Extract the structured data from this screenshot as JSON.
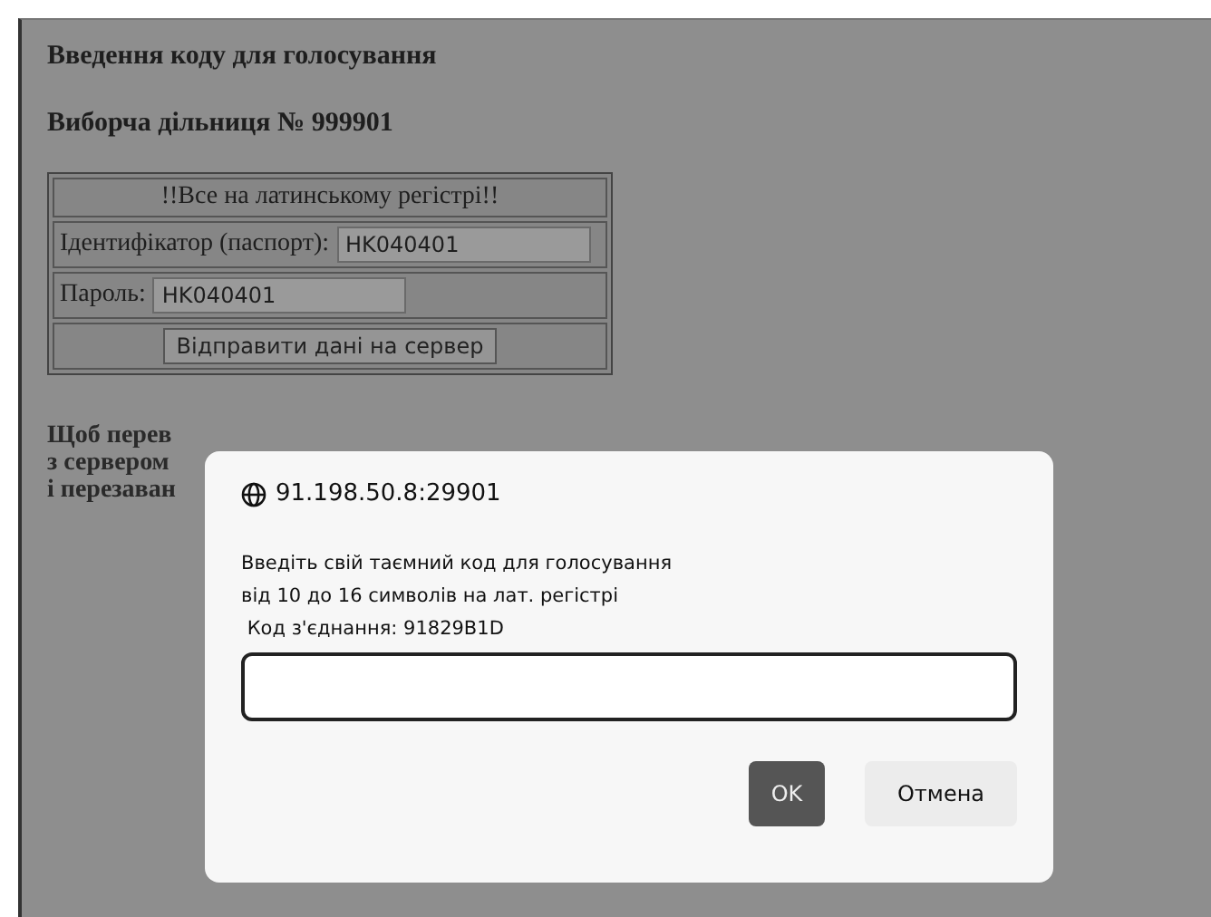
{
  "page": {
    "title": "Введення коду для голосування",
    "subtitle": "Виборча дільниця № 999901"
  },
  "login_table": {
    "notice": "!!Все на латинському регістрі!!",
    "fields": [
      {
        "label": "Ідентифікатор (паспорт):",
        "value": "HK040401"
      },
      {
        "label": "Пароль:",
        "value": "HK040401"
      }
    ],
    "submit": "Відправити дані на сервер"
  },
  "note_lines": [
    "Щоб перев",
    "з сервером",
    "і перезаван"
  ],
  "dialog": {
    "origin": "91.198.50.8:29901",
    "message_lines": [
      "Введіть свій таємний код для голосування",
      "від 10 до 16 символів на лат. регістрі",
      " Код з'єднання: 91829B1D"
    ],
    "buttons": [
      {
        "label": "OK",
        "kind": "primary"
      },
      {
        "label": "Отмена",
        "kind": "secondary"
      }
    ]
  }
}
